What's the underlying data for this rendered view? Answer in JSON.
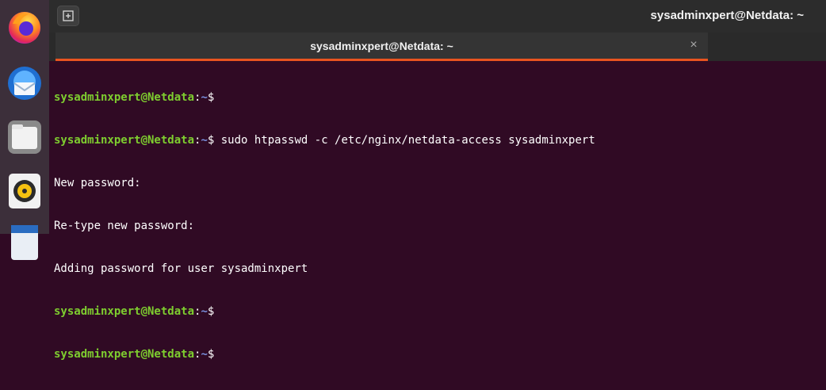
{
  "window": {
    "title": "sysadminxpert@Netdata: ~",
    "new_tab_icon": "new-tab-icon"
  },
  "tab": {
    "label": "sysadminxpert@Netdata: ~",
    "close_glyph": "×"
  },
  "dock": {
    "items": [
      "firefox-icon",
      "thunderbird-icon",
      "files-icon",
      "rhythmbox-icon",
      "libreoffice-writer-icon"
    ]
  },
  "colors": {
    "terminal_bg": "#300a24",
    "prompt_user": "#7ecd2f",
    "prompt_path": "#7a91e0",
    "tab_accent": "#e95420"
  },
  "terminal": {
    "prompt": {
      "user": "sysadminxpert@Netdata",
      "sep": ":",
      "path": "~",
      "symbol": "$"
    },
    "command": " sudo htpasswd -c /etc/nginx/netdata-access sysadminxpert",
    "output": [
      "New password:",
      "Re-type new password:",
      "Adding password for user sysadminxpert"
    ]
  }
}
